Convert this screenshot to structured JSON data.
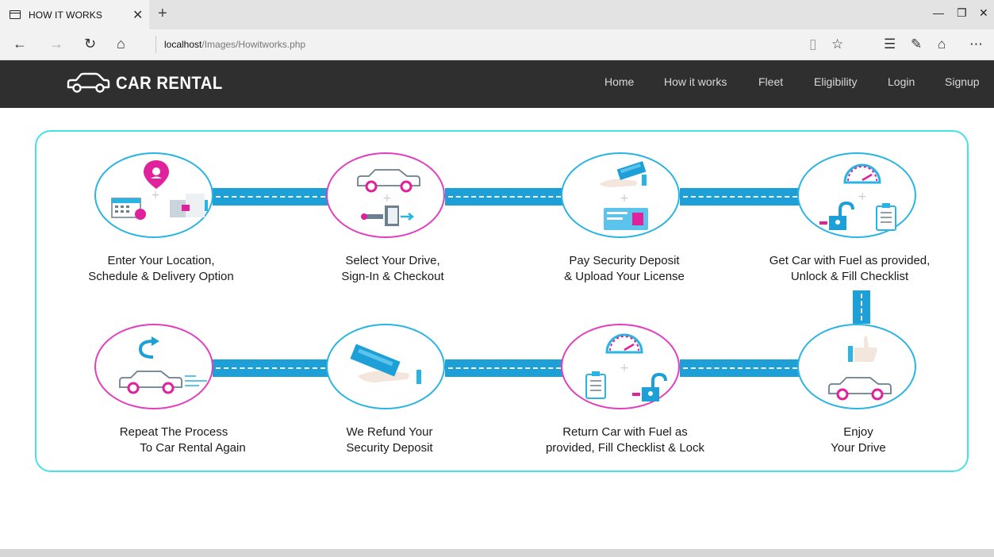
{
  "browser": {
    "tab_title": "HOW IT WORKS",
    "url_host": "localhost",
    "url_path": "/Images/Howitworks.php"
  },
  "site": {
    "brand": "CAR RENTAL",
    "menu": [
      "Home",
      "How it works",
      "Fleet",
      "Eligibility",
      "Login",
      "Signup"
    ]
  },
  "steps": [
    {
      "line1": "Enter Your Location,",
      "line2": "Schedule & Delivery Option"
    },
    {
      "line1": "Select Your Drive,",
      "line2": "Sign-In & Checkout"
    },
    {
      "line1": "Pay Security Deposit",
      "line2": "& Upload Your License"
    },
    {
      "line1": "Get Car with Fuel as provided,",
      "line2": "Unlock & Fill Checklist"
    },
    {
      "line1": "Enjoy",
      "line2": "Your Drive"
    },
    {
      "line1": "Return Car with Fuel as",
      "line2": "provided, Fill Checklist & Lock"
    },
    {
      "line1": "We Refund Your",
      "line2": "Security Deposit"
    },
    {
      "line1": "Repeat The Process",
      "line2": "To Car Rental Again"
    }
  ],
  "colors": {
    "nav_bg": "#2f2f2f",
    "card_border": "#46e0ea",
    "connector": "#1da0d7",
    "circle_blue": "#29b4e4",
    "circle_pink": "#e23fbf"
  }
}
